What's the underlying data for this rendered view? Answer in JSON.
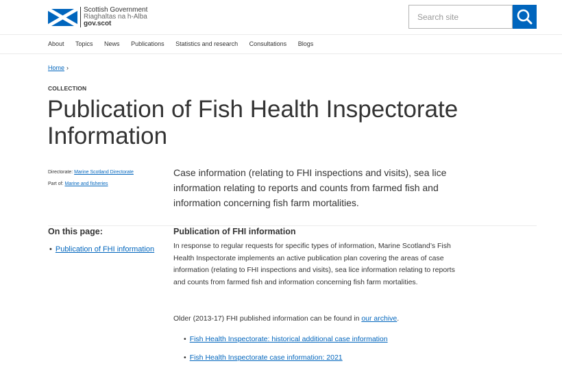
{
  "header": {
    "logo_line1": "Scottish Government",
    "logo_line2": "Riaghaltas na h-Alba",
    "logo_line3": "gov.scot",
    "search_placeholder": "Search site",
    "search_icon": "search-icon",
    "accent_color": "#0065bd"
  },
  "nav": {
    "items": [
      "About",
      "Topics",
      "News",
      "Publications",
      "Statistics and research",
      "Consultations",
      "Blogs"
    ]
  },
  "breadcrumb": {
    "home": "Home",
    "separator": "›"
  },
  "page": {
    "label": "COLLECTION",
    "title": "Publication of Fish Health Inspectorate Information",
    "directorate_label": "Directorate:",
    "directorate_link": "Marine Scotland Directorate",
    "partof_label": "Part of:",
    "partof_link": "Marine and fisheries",
    "summary": "Case information (relating to FHI inspections and visits), sea lice information relating to reports and counts from farmed fish and information concerning fish farm mortalities."
  },
  "on_this_page": {
    "title": "On this page:",
    "items": [
      "Publication of FHI information"
    ]
  },
  "section": {
    "title": "Publication of FHI information",
    "paragraph": "In response to regular requests for specific types of information, Marine Scotland’s Fish Health Inspectorate implements an active publication plan covering the areas of case information (relating to FHI inspections and visits), sea lice information relating to reports and counts from farmed fish and information concerning fish farm mortalities.",
    "archive_text_before": "Older (2013-17) FHI published information can be found in ",
    "archive_link": "our archive",
    "archive_text_after": ".",
    "links": [
      "Fish Health Inspectorate: historical additional case information",
      "Fish Health Inspectorate case information: 2021"
    ]
  }
}
